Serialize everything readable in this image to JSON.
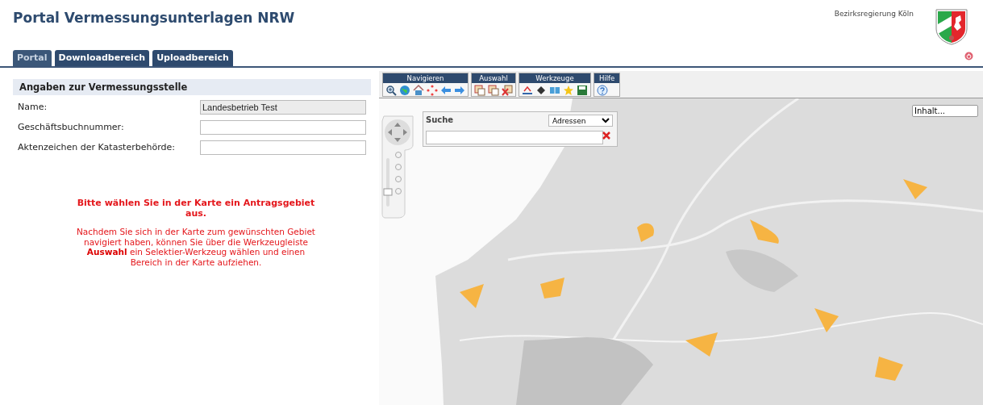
{
  "header": {
    "title": "Portal Vermessungsunterlagen NRW",
    "authority": "Bezirksregierung Köln"
  },
  "tabs": [
    {
      "label": "Portal",
      "selected": true
    },
    {
      "label": "Downloadbereich",
      "selected": false
    },
    {
      "label": "Uploadbereich",
      "selected": false
    }
  ],
  "panel": {
    "heading": "Angaben zur Vermessungsstelle",
    "fields": [
      {
        "label": "Name:",
        "value": "Landesbetrieb Test",
        "disabled": true
      },
      {
        "label": "Geschäftsbuchnummer:",
        "disabled": false
      },
      {
        "label": "Aktenzeichen der Katasterbehörde:",
        "disabled": false
      }
    ],
    "notice_title": "Bitte wählen Sie in der Karte ein Antragsgebiet aus.",
    "notice_body": "Nachdem Sie sich in der Karte zum gewünschten Gebiet navigiert haben, können Sie über die Werkzeugleiste **Auswahl** ein Selektier-Werkzeug wählen und einen Bereich in der Karte aufziehen."
  },
  "toolbar": [
    {
      "label": "Navigieren",
      "tools": [
        {
          "kind": "zoom"
        },
        {
          "kind": "globe"
        },
        {
          "kind": "home"
        },
        {
          "kind": "pan"
        },
        {
          "kind": "back"
        },
        {
          "kind": "forward"
        }
      ]
    },
    {
      "label": "Auswahl",
      "tools": [
        {
          "kind": "select"
        },
        {
          "kind": "select"
        },
        {
          "kind": "select-remove"
        }
      ]
    },
    {
      "label": "Werkzeuge",
      "tools": [
        {
          "kind": "measure"
        },
        {
          "kind": "fill"
        },
        {
          "kind": "book"
        },
        {
          "kind": "star"
        },
        {
          "kind": "save"
        }
      ]
    },
    {
      "label": "Hilfe",
      "tools": [
        {
          "kind": "help"
        }
      ]
    }
  ],
  "search": {
    "title": "Suche",
    "category": "Adressen"
  },
  "layer_field": {
    "value": "Inhalt..."
  }
}
